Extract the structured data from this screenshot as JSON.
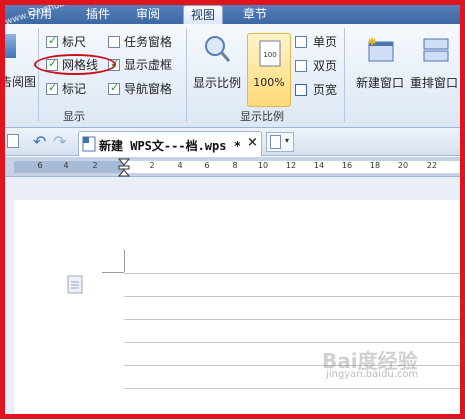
{
  "tabs": [
    {
      "label": "引用"
    },
    {
      "label": "插件"
    },
    {
      "label": "审阅"
    },
    {
      "label": "视图"
    },
    {
      "label": "章节"
    }
  ],
  "ribbon": {
    "partial_left_label": "告阅图",
    "show_group": {
      "label": "显示",
      "items": [
        {
          "label": "标尺",
          "checked": true
        },
        {
          "label": "网格线",
          "checked": true
        },
        {
          "label": "标记",
          "checked": true
        },
        {
          "label": "任务窗格",
          "checked": false
        },
        {
          "label": "显示虚框",
          "checked": true
        },
        {
          "label": "导航窗格",
          "checked": true
        }
      ]
    },
    "zoom_group": {
      "label": "显示比例",
      "zoom_button": "显示比例",
      "percent_button": "100%",
      "page_buttons": [
        {
          "label": "单页"
        },
        {
          "label": "双页"
        },
        {
          "label": "页宽"
        }
      ]
    },
    "window_group": {
      "new_window": "新建窗口",
      "rearrange": "重排窗口"
    }
  },
  "doc_tab": {
    "title": "新建 WPS文---档.wps *",
    "close": "×"
  },
  "ruler": {
    "ticks": [
      "6",
      "4",
      "2",
      "2",
      "4",
      "6",
      "8",
      "10",
      "12",
      "14",
      "16",
      "18",
      "20",
      "22"
    ]
  },
  "watermark": {
    "top": "www.kanzhuanhan.cn",
    "baidu": "Bai度经验",
    "url": "jingyan.baidu.com"
  },
  "colors": {
    "frame": "#e0141e",
    "ellipse": "#c8101c",
    "tab_bar": "#4a76b2",
    "checkmark": "#1a9a2a"
  }
}
